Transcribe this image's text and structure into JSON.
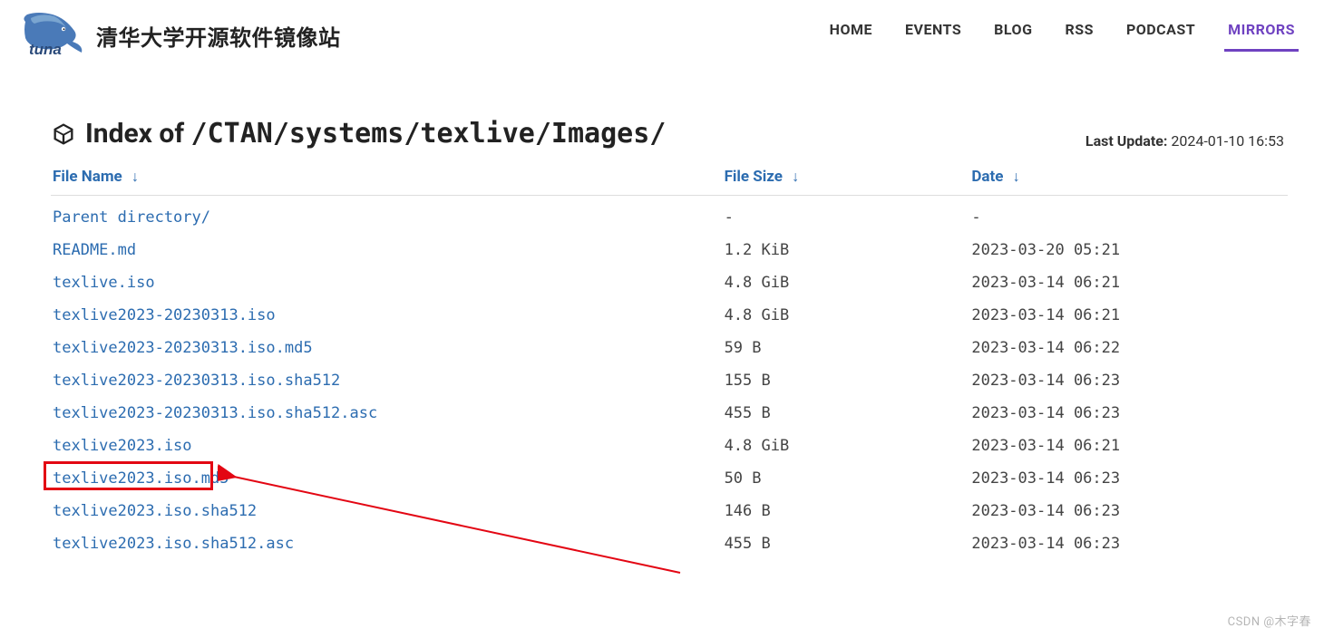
{
  "header": {
    "site_title": "清华大学开源软件镜像站",
    "nav": [
      {
        "label": "HOME",
        "active": false
      },
      {
        "label": "EVENTS",
        "active": false
      },
      {
        "label": "BLOG",
        "active": false
      },
      {
        "label": "RSS",
        "active": false
      },
      {
        "label": "PODCAST",
        "active": false
      },
      {
        "label": "MIRRORS",
        "active": true
      }
    ]
  },
  "page": {
    "heading_prefix": "Index of ",
    "heading_path": "/CTAN/systems/texlive/Images/",
    "last_update_label": "Last Update:",
    "last_update_value": "2024-01-10 16:53"
  },
  "columns": {
    "name": "File Name",
    "size": "File Size",
    "date": "Date"
  },
  "files": [
    {
      "name": "Parent directory/",
      "size": "-",
      "date": "-"
    },
    {
      "name": "README.md",
      "size": "1.2 KiB",
      "date": "2023-03-20 05:21"
    },
    {
      "name": "texlive.iso",
      "size": "4.8 GiB",
      "date": "2023-03-14 06:21"
    },
    {
      "name": "texlive2023-20230313.iso",
      "size": "4.8 GiB",
      "date": "2023-03-14 06:21"
    },
    {
      "name": "texlive2023-20230313.iso.md5",
      "size": "59 B",
      "date": "2023-03-14 06:22"
    },
    {
      "name": "texlive2023-20230313.iso.sha512",
      "size": "155 B",
      "date": "2023-03-14 06:23"
    },
    {
      "name": "texlive2023-20230313.iso.sha512.asc",
      "size": "455 B",
      "date": "2023-03-14 06:23"
    },
    {
      "name": "texlive2023.iso",
      "size": "4.8 GiB",
      "date": "2023-03-14 06:21",
      "highlight": true
    },
    {
      "name": "texlive2023.iso.md5",
      "size": "50 B",
      "date": "2023-03-14 06:23"
    },
    {
      "name": "texlive2023.iso.sha512",
      "size": "146 B",
      "date": "2023-03-14 06:23"
    },
    {
      "name": "texlive2023.iso.sha512.asc",
      "size": "455 B",
      "date": "2023-03-14 06:23"
    }
  ],
  "watermark": "CSDN @木字春"
}
